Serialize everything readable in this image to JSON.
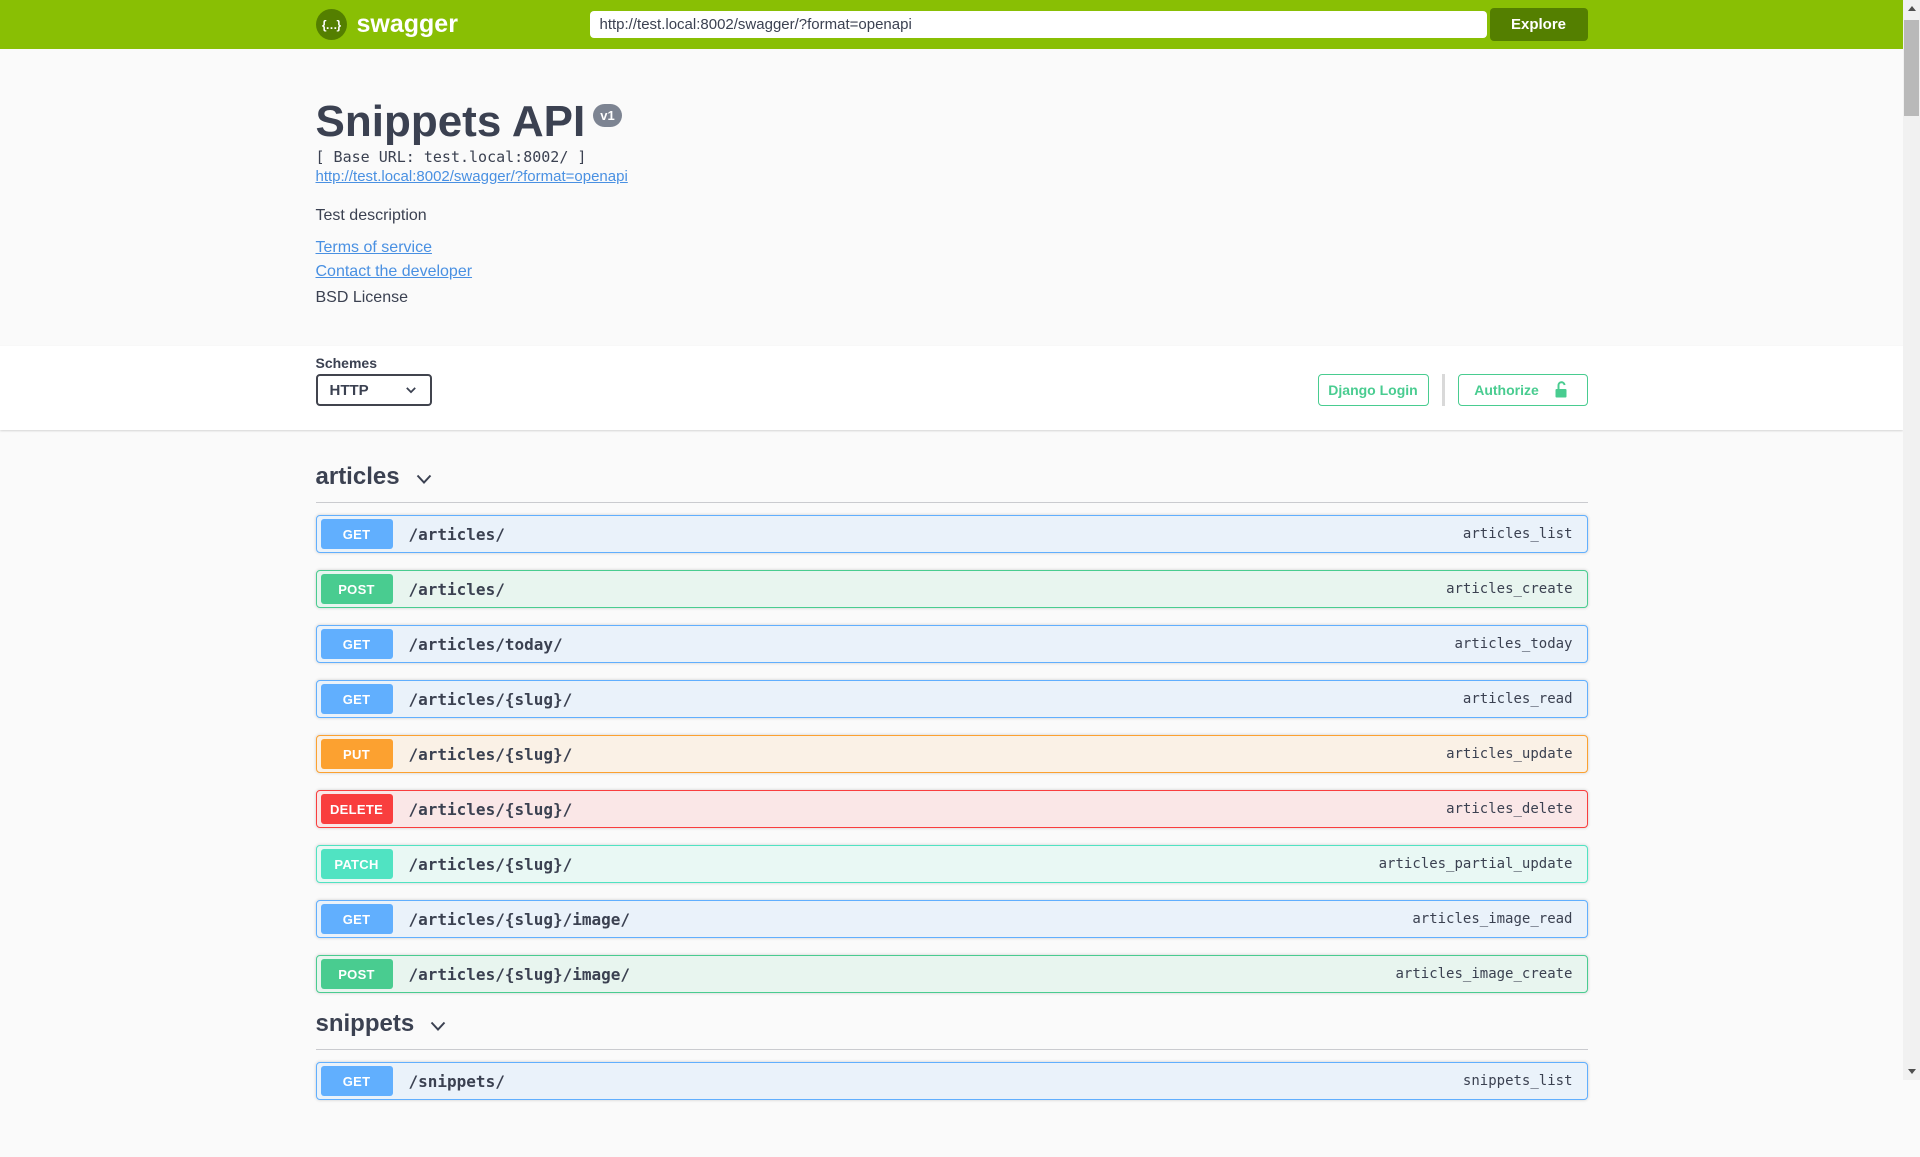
{
  "topbar": {
    "brand": "swagger",
    "logo_glyph": "{…}",
    "url_value": "http://test.local:8002/swagger/?format=openapi",
    "explore_label": "Explore"
  },
  "info": {
    "title": "Snippets API",
    "version_badge": "v1",
    "base_url": "[ Base URL: test.local:8002/ ]",
    "spec_link": "http://test.local:8002/swagger/?format=openapi",
    "description": "Test description",
    "terms_link": "Terms of service",
    "contact_link": "Contact the developer",
    "license": "BSD License"
  },
  "scheme": {
    "label": "Schemes",
    "selected": "HTTP",
    "django_login_label": "Django Login",
    "authorize_label": "Authorize"
  },
  "colors": {
    "topbar_bg": "#89bf04",
    "explore_bg": "#547f00",
    "accent_green": "#49cc90",
    "link_blue": "#4990e2",
    "text": "#3b4151",
    "page_bg": "#fafafa",
    "version_badge_bg": "#7d8492",
    "methods": {
      "GET": "#61affe",
      "POST": "#49cc90",
      "PUT": "#fca130",
      "DELETE": "#f93e3e",
      "PATCH": "#50e3c2"
    }
  },
  "sections": [
    {
      "name": "articles",
      "operations": [
        {
          "method": "GET",
          "path": "/articles/",
          "op_id": "articles_list"
        },
        {
          "method": "POST",
          "path": "/articles/",
          "op_id": "articles_create"
        },
        {
          "method": "GET",
          "path": "/articles/today/",
          "op_id": "articles_today"
        },
        {
          "method": "GET",
          "path": "/articles/{slug}/",
          "op_id": "articles_read"
        },
        {
          "method": "PUT",
          "path": "/articles/{slug}/",
          "op_id": "articles_update"
        },
        {
          "method": "DELETE",
          "path": "/articles/{slug}/",
          "op_id": "articles_delete"
        },
        {
          "method": "PATCH",
          "path": "/articles/{slug}/",
          "op_id": "articles_partial_update"
        },
        {
          "method": "GET",
          "path": "/articles/{slug}/image/",
          "op_id": "articles_image_read"
        },
        {
          "method": "POST",
          "path": "/articles/{slug}/image/",
          "op_id": "articles_image_create"
        }
      ]
    },
    {
      "name": "snippets",
      "operations": [
        {
          "method": "GET",
          "path": "/snippets/",
          "op_id": "snippets_list"
        }
      ]
    }
  ]
}
